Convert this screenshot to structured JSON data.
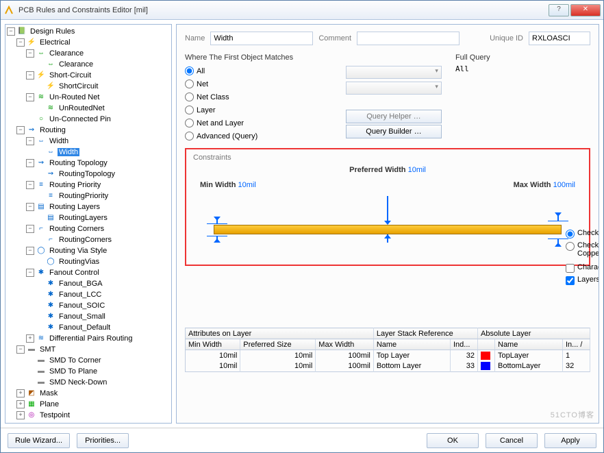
{
  "title": "PCB Rules and Constraints Editor [mil]",
  "tree": {
    "root": "Design Rules",
    "n_electrical": "Electrical",
    "n_clearance_g": "Clearance",
    "n_clearance": "Clearance",
    "n_shortcircuit_g": "Short-Circuit",
    "n_shortcircuit": "ShortCircuit",
    "n_unrouted_g": "Un-Routed Net",
    "n_unrouted": "UnRoutedNet",
    "n_unconnectedpin": "Un-Connected Pin",
    "n_routing": "Routing",
    "n_width_g": "Width",
    "n_width": "Width",
    "n_topo_g": "Routing Topology",
    "n_topo": "RoutingTopology",
    "n_prio_g": "Routing Priority",
    "n_prio": "RoutingPriority",
    "n_layers_g": "Routing Layers",
    "n_layers": "RoutingLayers",
    "n_corners_g": "Routing Corners",
    "n_corners": "RoutingCorners",
    "n_via_g": "Routing Via Style",
    "n_via": "RoutingVias",
    "n_fanout_g": "Fanout Control",
    "n_fanout_bga": "Fanout_BGA",
    "n_fanout_lcc": "Fanout_LCC",
    "n_fanout_soic": "Fanout_SOIC",
    "n_fanout_small": "Fanout_Small",
    "n_fanout_default": "Fanout_Default",
    "n_diffpairs": "Differential Pairs Routing",
    "n_smt": "SMT",
    "n_smd_corner": "SMD To Corner",
    "n_smd_plane": "SMD To Plane",
    "n_smd_neck": "SMD Neck-Down",
    "n_mask": "Mask",
    "n_plane": "Plane",
    "n_testpoint": "Testpoint"
  },
  "form": {
    "name_lbl": "Name",
    "name_val": "Width",
    "comment_lbl": "Comment",
    "comment_val": "",
    "uid_lbl": "Unique ID",
    "uid_val": "RXLOASCI"
  },
  "match": {
    "title": "Where The First Object Matches",
    "r_all": "All",
    "r_net": "Net",
    "r_netclass": "Net Class",
    "r_layer": "Layer",
    "r_netlayer": "Net and Layer",
    "r_adv": "Advanced (Query)",
    "btn_helper": "Query Helper …",
    "btn_builder": "Query Builder …"
  },
  "query": {
    "title": "Full Query",
    "value": "All"
  },
  "constraints": {
    "title": "Constraints",
    "pref_lbl": "Preferred Width",
    "pref_val": "10mil",
    "min_lbl": "Min Width",
    "min_val": "10mil",
    "max_lbl": "Max Width",
    "max_val": "100mil"
  },
  "checks": {
    "c1": "Check Tracks/Arcs Min/Max Width Individually",
    "c2": "Check Min/Max Width for Physically Connected Copper (tracks, arcs, fills, pads & vias)",
    "c3": "Characteristic Impedance Driven Width",
    "c4": "Layers in layerstack only"
  },
  "grid": {
    "g1": "Attributes on Layer",
    "g2": "Layer Stack Reference",
    "g3": "Absolute Layer",
    "h_min": "Min Width",
    "h_pref": "Preferred Size",
    "h_max": "Max Width",
    "h_name": "Name",
    "h_ind": "Ind...",
    "h_name2": "Name",
    "h_in": "In... /",
    "rows": [
      {
        "min": "10mil",
        "pref": "10mil",
        "max": "100mil",
        "sname": "Top Layer",
        "ind": "32",
        "color": "#ff0000",
        "aname": "TopLayer",
        "ain": "1"
      },
      {
        "min": "10mil",
        "pref": "10mil",
        "max": "100mil",
        "sname": "Bottom Layer",
        "ind": "33",
        "color": "#0000ff",
        "aname": "BottomLayer",
        "ain": "32"
      }
    ]
  },
  "footer": {
    "rule_wizard": "Rule Wizard...",
    "priorities": "Priorities...",
    "ok": "OK",
    "cancel": "Cancel",
    "apply": "Apply"
  },
  "watermark": "51CTO博客"
}
